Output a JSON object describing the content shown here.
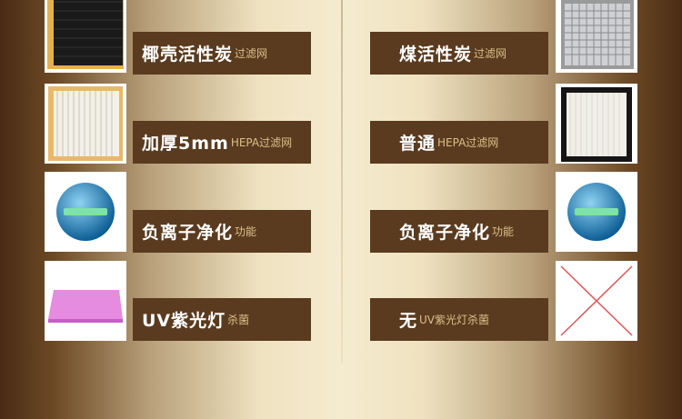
{
  "left": [
    {
      "main": "椰壳活性炭",
      "sub": "过滤网",
      "icon": "carbon-filter"
    },
    {
      "main": "加厚5mm",
      "sub": "HEPA过滤网",
      "icon": "hepa-filter"
    },
    {
      "main": "负离子净化",
      "sub": "功能",
      "icon": "ion-sphere"
    },
    {
      "main": "UV紫光灯",
      "sub": "杀菌",
      "icon": "uv-lamp"
    }
  ],
  "right": [
    {
      "main": "煤活性炭",
      "sub": "过滤网",
      "icon": "carbon-filter"
    },
    {
      "main": "普通",
      "sub": "HEPA过滤网",
      "icon": "hepa-filter"
    },
    {
      "main": "负离子净化",
      "sub": "功能",
      "icon": "ion-sphere"
    },
    {
      "main": "无",
      "sub": "UV紫光灯杀菌",
      "icon": "x-mark"
    }
  ]
}
